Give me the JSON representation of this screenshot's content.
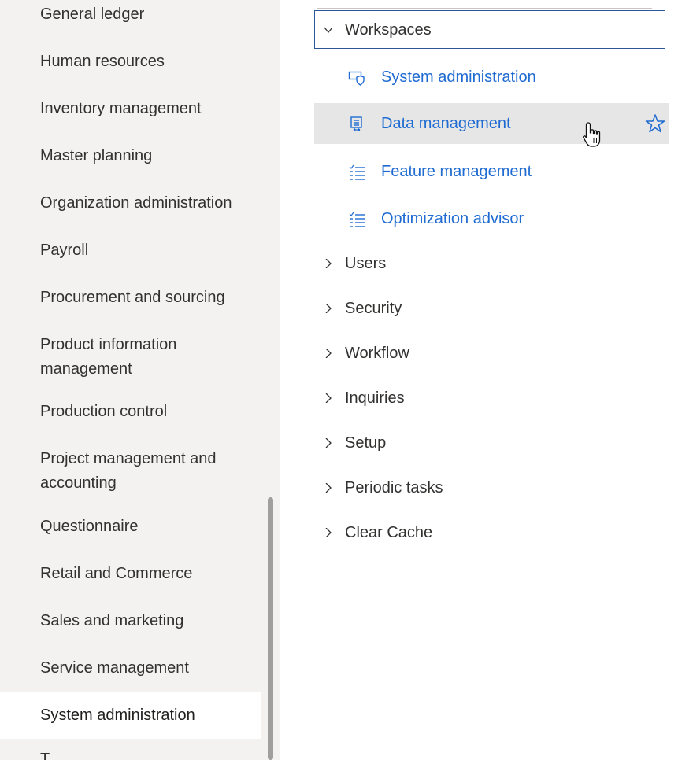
{
  "left_nav": {
    "items": [
      "General ledger",
      "Human resources",
      "Inventory management",
      "Master planning",
      "Organization administration",
      "Payroll",
      "Procurement and sourcing",
      "Product information management",
      "Production control",
      "Project management and accounting",
      "Questionnaire",
      "Retail and Commerce",
      "Sales and marketing",
      "Service management",
      "System administration"
    ],
    "item_line2": {
      "product_information": "management",
      "project_management": "accounting"
    },
    "item_line1": {
      "product_information": "Product information",
      "project_management": "Project management and"
    },
    "selected": "System administration",
    "partial_next": "T..."
  },
  "workspaces": {
    "header": "Workspaces",
    "links": [
      {
        "label": "System administration",
        "icon": "shield-screen-icon"
      },
      {
        "label": "Data management",
        "icon": "data-management-icon"
      },
      {
        "label": "Feature management",
        "icon": "list-icon"
      },
      {
        "label": "Optimization advisor",
        "icon": "list-icon"
      }
    ]
  },
  "groups": [
    "Users",
    "Security",
    "Workflow",
    "Inquiries",
    "Setup",
    "Periodic tasks",
    "Clear Cache"
  ],
  "colors": {
    "link": "#1f6bd1",
    "nav_bg": "#f3f2f1",
    "hover_bg": "#e6e6e6",
    "focus_border": "#2b5797"
  }
}
